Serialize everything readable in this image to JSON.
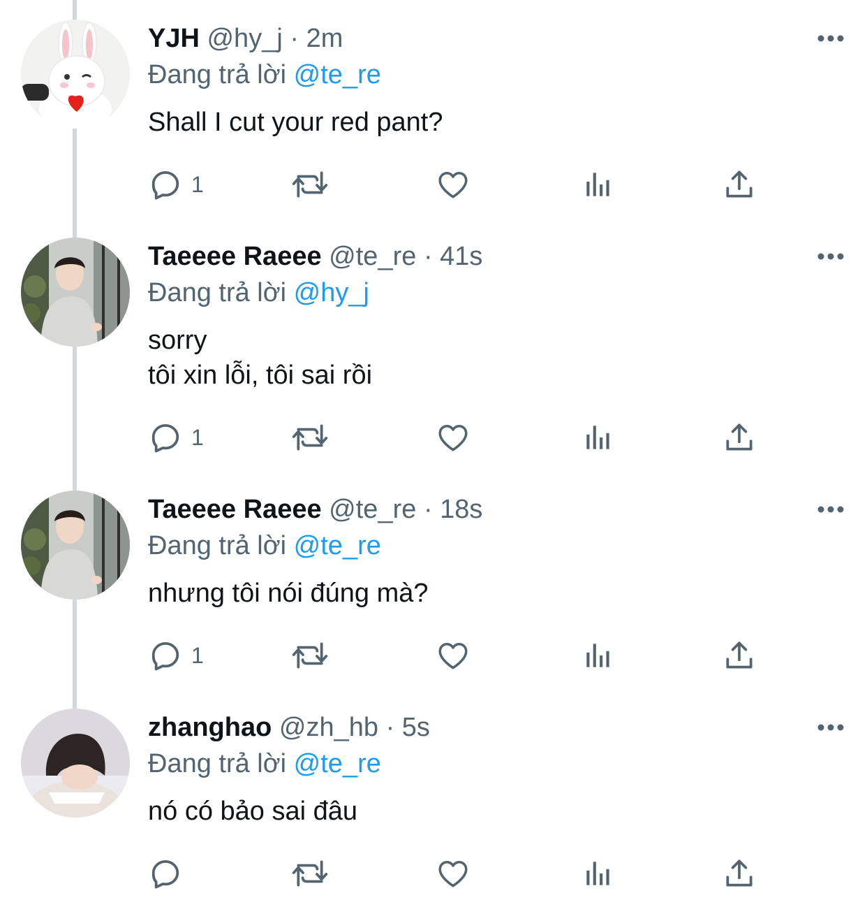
{
  "tweets": [
    {
      "name": "YJH",
      "handle": "@hy_j",
      "dot": "·",
      "time": "2m",
      "reply_prefix": "Đang trả lời",
      "reply_to": "@te_re",
      "lines": [
        "Shall I cut your red pant?"
      ],
      "reply_count": "1",
      "avatar": "bunny-avatar"
    },
    {
      "name": "Taeeee Raeee",
      "handle": "@te_re",
      "dot": "·",
      "time": "41s",
      "reply_prefix": "Đang trả lời",
      "reply_to": "@hy_j",
      "lines": [
        "sorry",
        "tôi xin lỗi, tôi sai rồi"
      ],
      "reply_count": "1",
      "avatar": "person-avatar"
    },
    {
      "name": "Taeeee Raeee",
      "handle": "@te_re",
      "dot": "·",
      "time": "18s",
      "reply_prefix": "Đang trả lời",
      "reply_to": "@te_re",
      "lines": [
        "nhưng tôi nói đúng mà?"
      ],
      "reply_count": "1",
      "avatar": "person-avatar"
    },
    {
      "name": "zhanghao",
      "handle": "@zh_hb",
      "dot": "·",
      "time": "5s",
      "reply_prefix": "Đang trả lời",
      "reply_to": "@te_re",
      "lines": [
        "nó có bảo sai đâu"
      ],
      "reply_count": "",
      "avatar": "sleeping-person-avatar"
    }
  ],
  "icons": {
    "reply": "reply-icon",
    "retweet": "retweet-icon",
    "like": "heart-icon",
    "views": "views-icon",
    "share": "share-icon",
    "more": "more-icon"
  },
  "colors": {
    "text": "#0f1419",
    "secondary": "#536471",
    "mention": "#1d9bf0",
    "thread_line": "#cfd9de"
  }
}
